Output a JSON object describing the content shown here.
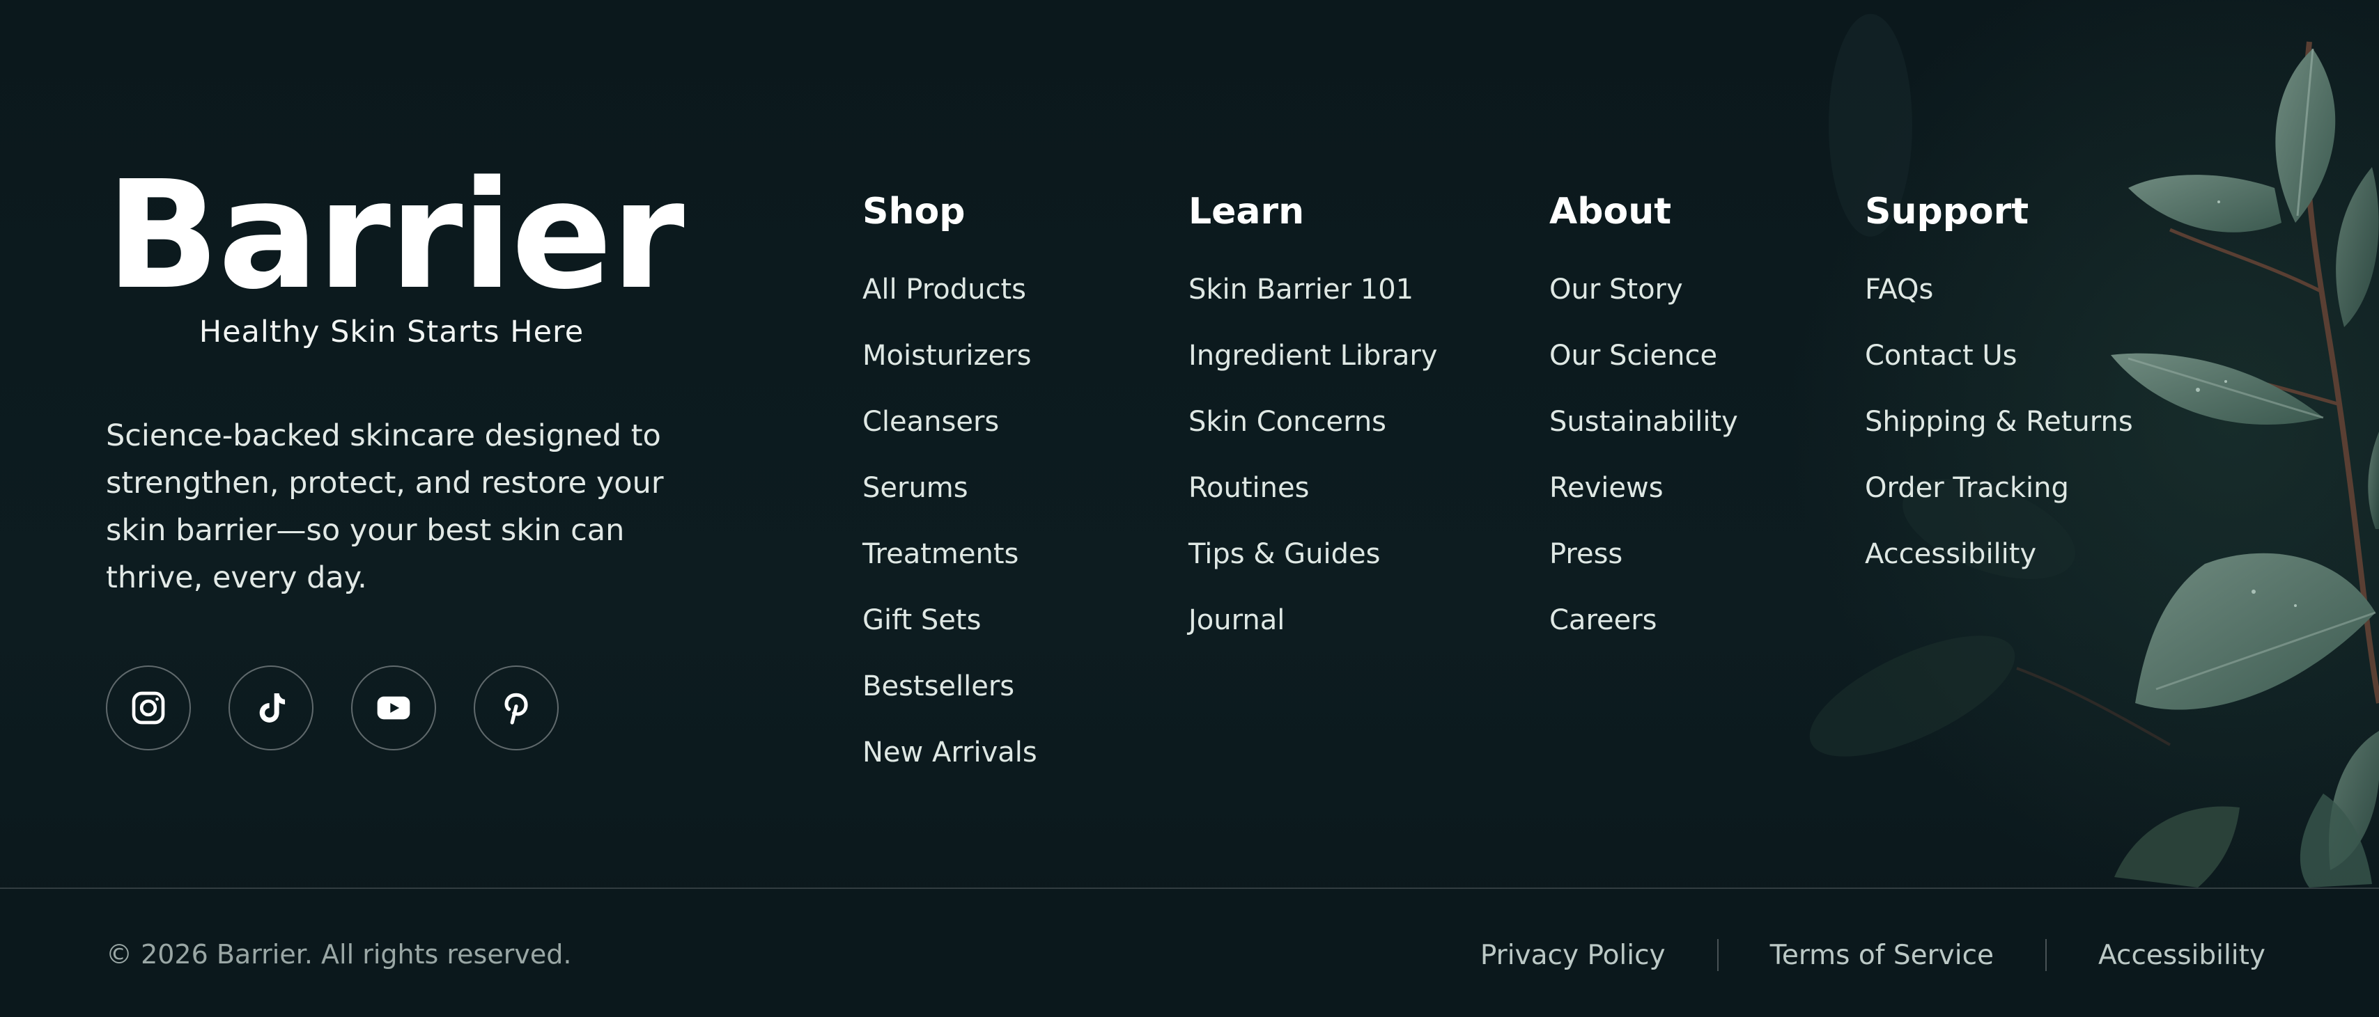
{
  "brand": {
    "name": "Barrier",
    "tagline": "Healthy Skin Starts Here",
    "description": "Science-backed skincare designed to strengthen, protect, and restore your skin barrier—so your best skin can thrive, every day."
  },
  "socials": [
    {
      "icon": "instagram-icon"
    },
    {
      "icon": "tiktok-icon"
    },
    {
      "icon": "youtube-icon"
    },
    {
      "icon": "pinterest-icon"
    }
  ],
  "columns": {
    "shop": {
      "title": "Shop",
      "items": [
        "All Products",
        "Moisturizers",
        "Cleansers",
        "Serums",
        "Treatments",
        "Gift Sets",
        "Bestsellers",
        "New Arrivals"
      ]
    },
    "learn": {
      "title": "Learn",
      "items": [
        "Skin Barrier 101",
        "Ingredient Library",
        "Skin Concerns",
        "Routines",
        "Tips & Guides",
        "Journal"
      ]
    },
    "about": {
      "title": "About",
      "items": [
        "Our Story",
        "Our Science",
        "Sustainability",
        "Reviews",
        "Press",
        "Careers"
      ]
    },
    "support": {
      "title": "Support",
      "items": [
        "FAQs",
        "Contact Us",
        "Shipping & Returns",
        "Order Tracking",
        "Accessibility"
      ]
    }
  },
  "bottom": {
    "copyright": "© 2026 Barrier. All rights reserved.",
    "links": [
      "Privacy Policy",
      "Terms of Service",
      "Accessibility"
    ]
  },
  "colors": {
    "background": "#0c1a1e",
    "text": "#e4ece8",
    "muted": "#9aa7a5",
    "leaf": "#4f6b60"
  }
}
